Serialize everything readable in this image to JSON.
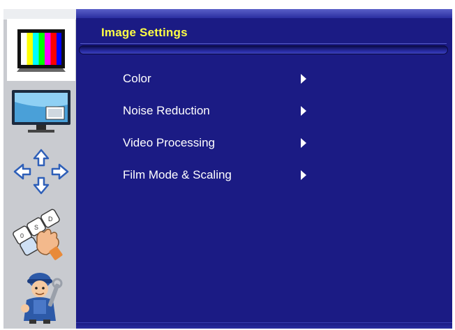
{
  "window": {
    "title": "Image Settings"
  },
  "sidebar": {
    "items": [
      {
        "name": "image",
        "icon": "tv-color-bars-icon",
        "active": true
      },
      {
        "name": "display",
        "icon": "monitor-pip-icon",
        "active": false
      },
      {
        "name": "position",
        "icon": "directional-arrows-icon",
        "active": false
      },
      {
        "name": "osd",
        "icon": "keyboard-hand-icon",
        "active": false
      },
      {
        "name": "service",
        "icon": "repairman-icon",
        "active": false
      }
    ]
  },
  "menu": {
    "items": [
      {
        "label": "Color",
        "arrow": "right-arrow-icon"
      },
      {
        "label": "Noise Reduction",
        "arrow": "right-arrow-icon"
      },
      {
        "label": "Video Processing",
        "arrow": "right-arrow-icon"
      },
      {
        "label": "Film Mode & Scaling",
        "arrow": "right-arrow-icon"
      }
    ]
  },
  "colors": {
    "panel": "#1b1b84",
    "title": "#ffff44",
    "text": "#ffffff",
    "sidebar": "#c9cbd0"
  }
}
